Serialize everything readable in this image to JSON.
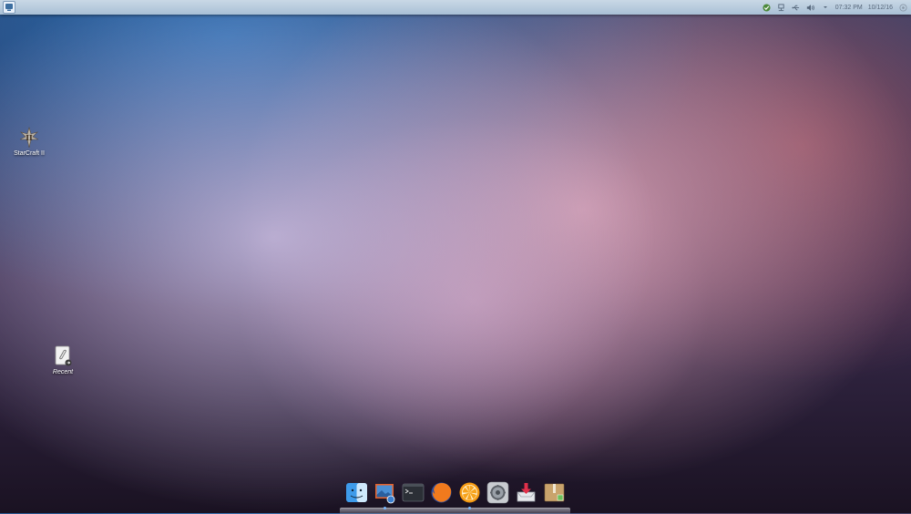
{
  "topbar": {
    "launcher_icon": "app-menu-icon",
    "tray": {
      "icons": [
        "shield-check-icon",
        "network-icon",
        "usb-icon",
        "volume-icon",
        "dropdown-arrow-icon",
        "session-icon"
      ],
      "time": "07:32 PM",
      "date": "10/12/16"
    }
  },
  "desktop": {
    "icons": [
      {
        "label": "StarCraft II",
        "icon": "starcraft-icon"
      },
      {
        "label": "Recent",
        "icon": "recent-icon"
      }
    ]
  },
  "dock": {
    "items": [
      {
        "name": "finder",
        "icon": "finder-icon",
        "running": false
      },
      {
        "name": "image-viewer",
        "icon": "photos-icon",
        "running": true
      },
      {
        "name": "terminal",
        "icon": "terminal-icon",
        "running": false
      },
      {
        "name": "firefox",
        "icon": "firefox-icon",
        "running": false
      },
      {
        "name": "music",
        "icon": "orange-icon",
        "running": true
      },
      {
        "name": "settings",
        "icon": "settings-gear-icon",
        "running": false
      },
      {
        "name": "downloads",
        "icon": "download-icon",
        "running": false
      },
      {
        "name": "archive",
        "icon": "archive-box-icon",
        "running": false
      }
    ]
  },
  "colors": {
    "topbar": "#b8ccdf",
    "wallpaper_blue": "#286eb4",
    "wallpaper_pink": "#d7a0b4",
    "wallpaper_dark": "#1a1222"
  }
}
